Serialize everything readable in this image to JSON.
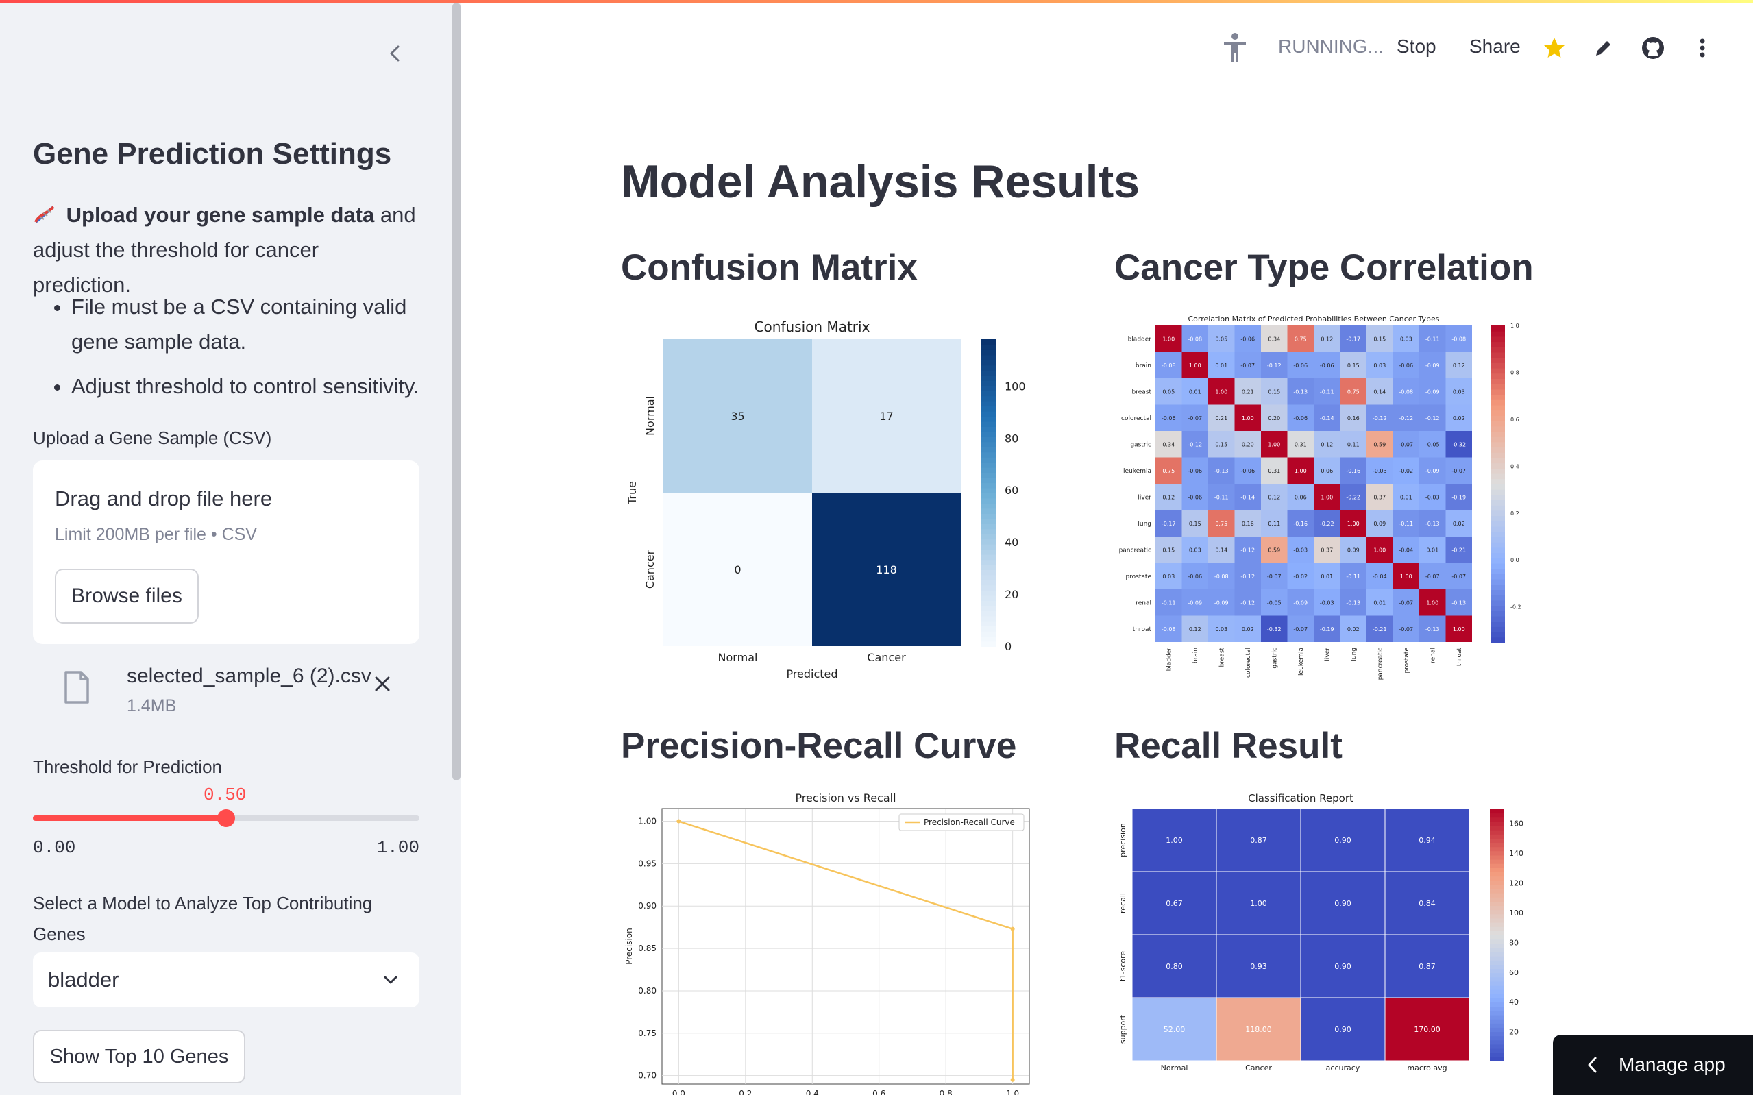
{
  "header": {
    "status": "RUNNING...",
    "stop_label": "Stop",
    "share_label": "Share",
    "icons": [
      "accessibility-icon",
      "star-icon",
      "pencil-icon",
      "github-icon",
      "more-vertical-icon"
    ],
    "star_color": "#f5c400"
  },
  "sidebar": {
    "title": "Gene Prediction Settings",
    "desc_icon": "dna-icon",
    "desc_bold": "Upload your gene sample data",
    "desc_rest": " and adjust the threshold for cancer prediction.",
    "bullets": [
      "File must be a CSV containing valid gene sample data.",
      "Adjust threshold to control sensitivity."
    ],
    "upload_label": "Upload a Gene Sample (CSV)",
    "upload_title": "Drag and drop file here",
    "upload_sub": "Limit 200MB per file • CSV",
    "browse_label": "Browse files",
    "file_name": "selected_sample_6 (2).csv",
    "file_size": "1.4MB",
    "threshold_label": "Threshold for Prediction",
    "threshold_value": "0.50",
    "threshold_fraction": 0.5,
    "threshold_min": "0.00",
    "threshold_max": "1.00",
    "model_label": "Select a Model to Analyze Top Contributing Genes",
    "model_value": "bladder",
    "show_genes_label": "Show Top 10 Genes",
    "accent_color": "#ff4b4b"
  },
  "main": {
    "title": "Model Analysis Results",
    "sections": [
      "Confusion Matrix",
      "Cancer Type Correlation",
      "Precision-Recall Curve",
      "Recall Result"
    ]
  },
  "manage_label": "Manage app",
  "chart_data": [
    {
      "type": "heatmap",
      "title": "Confusion Matrix",
      "xlabel": "Predicted",
      "ylabel": "True",
      "x_categories": [
        "Normal",
        "Cancer"
      ],
      "y_categories": [
        "Normal",
        "Cancer"
      ],
      "values": [
        [
          35,
          17
        ],
        [
          0,
          118
        ]
      ],
      "colorbar_ticks": [
        0,
        20,
        40,
        60,
        80,
        100
      ],
      "colormap": "Blues"
    },
    {
      "type": "heatmap",
      "title": "Correlation Matrix of Predicted Probabilities Between Cancer Types",
      "categories": [
        "bladder",
        "brain",
        "breast",
        "colorectal",
        "gastric",
        "leukemia",
        "liver",
        "lung",
        "pancreatic",
        "prostate",
        "renal",
        "throat"
      ],
      "values": [
        [
          1.0,
          -0.08,
          0.05,
          -0.06,
          0.34,
          0.75,
          0.12,
          -0.17,
          0.15,
          0.03,
          -0.11,
          -0.08
        ],
        [
          -0.08,
          1.0,
          0.01,
          -0.07,
          -0.12,
          -0.06,
          -0.06,
          0.15,
          0.03,
          -0.06,
          -0.09,
          0.12
        ],
        [
          0.05,
          0.01,
          1.0,
          0.21,
          0.15,
          -0.13,
          -0.11,
          0.75,
          0.14,
          -0.08,
          -0.09,
          0.03
        ],
        [
          -0.06,
          -0.07,
          0.21,
          1.0,
          0.2,
          -0.06,
          -0.14,
          0.16,
          -0.12,
          -0.12,
          -0.12,
          0.02
        ],
        [
          0.34,
          -0.12,
          0.15,
          0.2,
          1.0,
          0.31,
          0.12,
          0.11,
          0.59,
          -0.07,
          -0.05,
          -0.32
        ],
        [
          0.75,
          -0.06,
          -0.13,
          -0.06,
          0.31,
          1.0,
          0.06,
          -0.16,
          -0.03,
          -0.02,
          -0.09,
          -0.07
        ],
        [
          0.12,
          -0.06,
          -0.11,
          -0.14,
          0.12,
          0.06,
          1.0,
          -0.22,
          0.37,
          0.01,
          -0.03,
          -0.19
        ],
        [
          -0.17,
          0.15,
          0.75,
          0.16,
          0.11,
          -0.16,
          -0.22,
          1.0,
          0.09,
          -0.11,
          -0.13,
          0.02
        ],
        [
          0.15,
          0.03,
          0.14,
          -0.12,
          0.59,
          -0.03,
          0.37,
          0.09,
          1.0,
          -0.04,
          0.01,
          -0.21
        ],
        [
          0.03,
          -0.06,
          -0.08,
          -0.12,
          -0.07,
          -0.02,
          0.01,
          -0.11,
          -0.04,
          1.0,
          -0.07,
          -0.07
        ],
        [
          -0.11,
          -0.09,
          -0.09,
          -0.12,
          -0.05,
          -0.09,
          -0.03,
          -0.13,
          0.01,
          -0.07,
          1.0,
          -0.13
        ],
        [
          -0.08,
          0.12,
          0.03,
          0.02,
          -0.32,
          -0.07,
          -0.19,
          0.02,
          -0.21,
          -0.07,
          -0.13,
          1.0
        ]
      ],
      "colorbar_ticks": [
        -0.2,
        0.0,
        0.2,
        0.4,
        0.6,
        0.8,
        1.0
      ],
      "colormap": "coolwarm"
    },
    {
      "type": "line",
      "title": "Precision vs Recall",
      "xlabel": "",
      "ylabel": "Precision",
      "series": [
        {
          "name": "Precision-Recall Curve",
          "x": [
            0.0,
            1.0,
            1.0
          ],
          "y": [
            1.0,
            0.873,
            0.695
          ]
        }
      ],
      "xlim": [
        -0.05,
        1.05
      ],
      "ylim": [
        0.69,
        1.015
      ],
      "x_ticks": [
        "0.0",
        "0.2",
        "0.4",
        "0.6",
        "0.8",
        "1.0"
      ],
      "y_ticks": [
        "0.70",
        "0.75",
        "0.80",
        "0.85",
        "0.90",
        "0.95",
        "1.00"
      ],
      "grid": true,
      "legend": "top-right",
      "color": "#f7c45c"
    },
    {
      "type": "heatmap",
      "title": "Classification Report",
      "x_categories": [
        "Normal",
        "Cancer",
        "accuracy",
        "macro avg"
      ],
      "y_categories": [
        "precision",
        "recall",
        "f1-score",
        "support"
      ],
      "values": [
        [
          1.0,
          0.87,
          0.9,
          0.94
        ],
        [
          0.67,
          1.0,
          0.9,
          0.84
        ],
        [
          0.8,
          0.93,
          0.9,
          0.87
        ],
        [
          52.0,
          118.0,
          0.9,
          170.0
        ]
      ],
      "colorbar_ticks": [
        20,
        40,
        60,
        80,
        100,
        120,
        140,
        160
      ],
      "colormap": "coolwarm"
    }
  ]
}
